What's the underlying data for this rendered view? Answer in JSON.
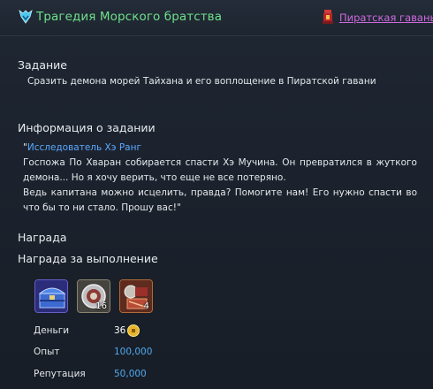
{
  "header": {
    "title": "Трагедия Морского братства",
    "location": "Пиратская гавань"
  },
  "objective": {
    "heading": "Задание",
    "text": "Сразить демона морей Тайхана и его воплощение в Пиратской гавани"
  },
  "info": {
    "heading": "Информация о задании",
    "quote_open": "\"",
    "speaker": "Исследователь Хэ Ранг",
    "paragraph1": "Госпожа По Хваран собирается спасти Хэ Мучина. Он превратился в жуткого демона... Но я хочу верить, что еще не все потеряно.",
    "paragraph2": "Ведь капитана можно исцелить, правда? Помогите нам! Его нужно спасти во что бы то ни стало. Прошу вас!\""
  },
  "reward": {
    "heading": "Награда",
    "subheading": "Награда за выполнение",
    "items": [
      {
        "icon": "treasure-chest-icon",
        "count": ""
      },
      {
        "icon": "silver-medallion-icon",
        "count": "16"
      },
      {
        "icon": "crafting-materials-icon",
        "count": "4"
      }
    ],
    "money_label": "Деньги",
    "money_value": "36",
    "exp_label": "Опыт",
    "exp_value": "100,000",
    "rep_label": "Репутация",
    "rep_value": "50,000"
  },
  "colors": {
    "title": "#6fe08a",
    "location": "#cf6adf",
    "speaker": "#5aa8ff",
    "reward_value": "#4fa9f0"
  }
}
